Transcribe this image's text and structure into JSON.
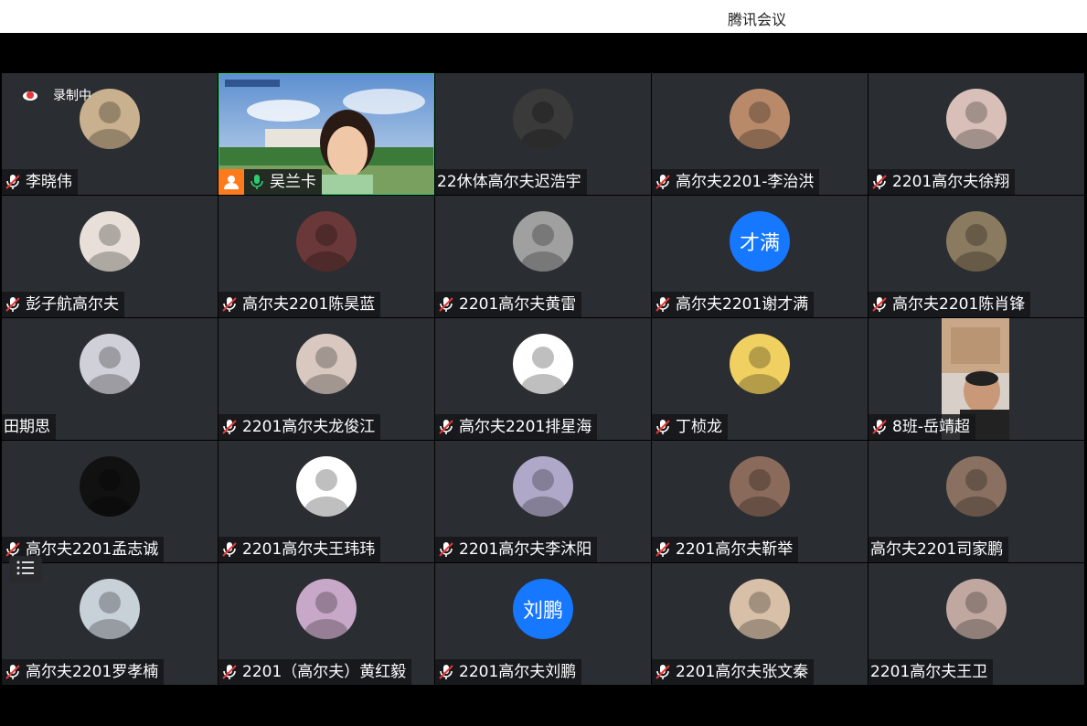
{
  "window": {
    "title": "腾讯会议"
  },
  "recording": {
    "label": "录制中"
  },
  "participants": [
    {
      "name": "李晓伟",
      "muted": true,
      "avatar": "photo-man-bookshelf",
      "bg": "#c9b08e"
    },
    {
      "name": "吴兰卡",
      "muted": false,
      "video": true
    },
    {
      "name": "22休体高尔夫迟浩宇",
      "muted": false,
      "avatar": "helmet-rider",
      "bg": "#3a3a3a"
    },
    {
      "name": "高尔夫2201-李治洪",
      "muted": true,
      "avatar": "track-field",
      "bg": "#b88a6a"
    },
    {
      "name": "2201高尔夫徐翔",
      "muted": true,
      "avatar": "anime-boy",
      "bg": "#d8c0b8"
    },
    {
      "name": "彭子航高尔夫",
      "muted": true,
      "avatar": "ultraman",
      "bg": "#e8e0d8"
    },
    {
      "name": "高尔夫2201陈昊蓝",
      "muted": true,
      "avatar": "anime-girl",
      "bg": "#6a3838"
    },
    {
      "name": "2201高尔夫黄雷",
      "muted": true,
      "avatar": "red-car",
      "bg": "#a0a0a0"
    },
    {
      "name": "高尔夫2201谢才满",
      "muted": true,
      "avatar_text": "才满"
    },
    {
      "name": "高尔夫2201陈肖锋",
      "muted": true,
      "avatar": "room-sofa",
      "bg": "#8a7a60"
    },
    {
      "name": "田期思",
      "muted": false,
      "avatar": "gundam",
      "bg": "#d0d0d8"
    },
    {
      "name": "2201高尔夫龙俊江",
      "muted": true,
      "avatar": "anime-white-hair",
      "bg": "#d8c8c0"
    },
    {
      "name": "高尔夫2201排星海",
      "muted": true,
      "avatar": "fries-cartoon",
      "bg": "#fff"
    },
    {
      "name": "丁桢龙",
      "muted": true,
      "avatar": "cartoon-dog",
      "bg": "#f0d060"
    },
    {
      "name": "8班-岳靖超",
      "muted": true,
      "video": true
    },
    {
      "name": "高尔夫2201孟志诚",
      "muted": true,
      "avatar": "dark-figures",
      "bg": "#111"
    },
    {
      "name": "2201高尔夫王玮玮",
      "muted": true,
      "avatar": "toast-cartoon",
      "bg": "#fff"
    },
    {
      "name": "2201高尔夫李沐阳",
      "muted": true,
      "avatar": "dancer-purple",
      "bg": "#b0a8c8"
    },
    {
      "name": "2201高尔夫靳举",
      "muted": true,
      "avatar": "green-frog",
      "bg": "#8a6a5a"
    },
    {
      "name": "高尔夫2201司家鹏",
      "muted": false,
      "avatar": "man-portrait",
      "bg": "#8a7060"
    },
    {
      "name": "高尔夫2201罗孝楠",
      "muted": true,
      "avatar": "smiling-man",
      "bg": "#c8d0d8"
    },
    {
      "name": "2201（高尔夫）黄红毅",
      "muted": true,
      "avatar": "pink-sky",
      "bg": "#c8a8c8"
    },
    {
      "name": "2201高尔夫刘鹏",
      "muted": true,
      "avatar_text": "刘鹏"
    },
    {
      "name": "2201高尔夫张文秦",
      "muted": true,
      "avatar": "baby-face",
      "bg": "#d8c0a8"
    },
    {
      "name": "2201高尔夫王卫",
      "muted": false,
      "avatar": "white-cat",
      "bg": "#c0a8a0"
    }
  ],
  "colors": {
    "tile_bg": "#2a2d31",
    "avatar_text_bg": "#1677ff",
    "speaking_border": "#2ecc71",
    "person_badge": "#ff7a1a"
  },
  "icons": {
    "mic_muted": "mic-muted-icon",
    "mic_on": "mic-icon",
    "recording": "cloud-record-icon",
    "list": "list-icon"
  }
}
